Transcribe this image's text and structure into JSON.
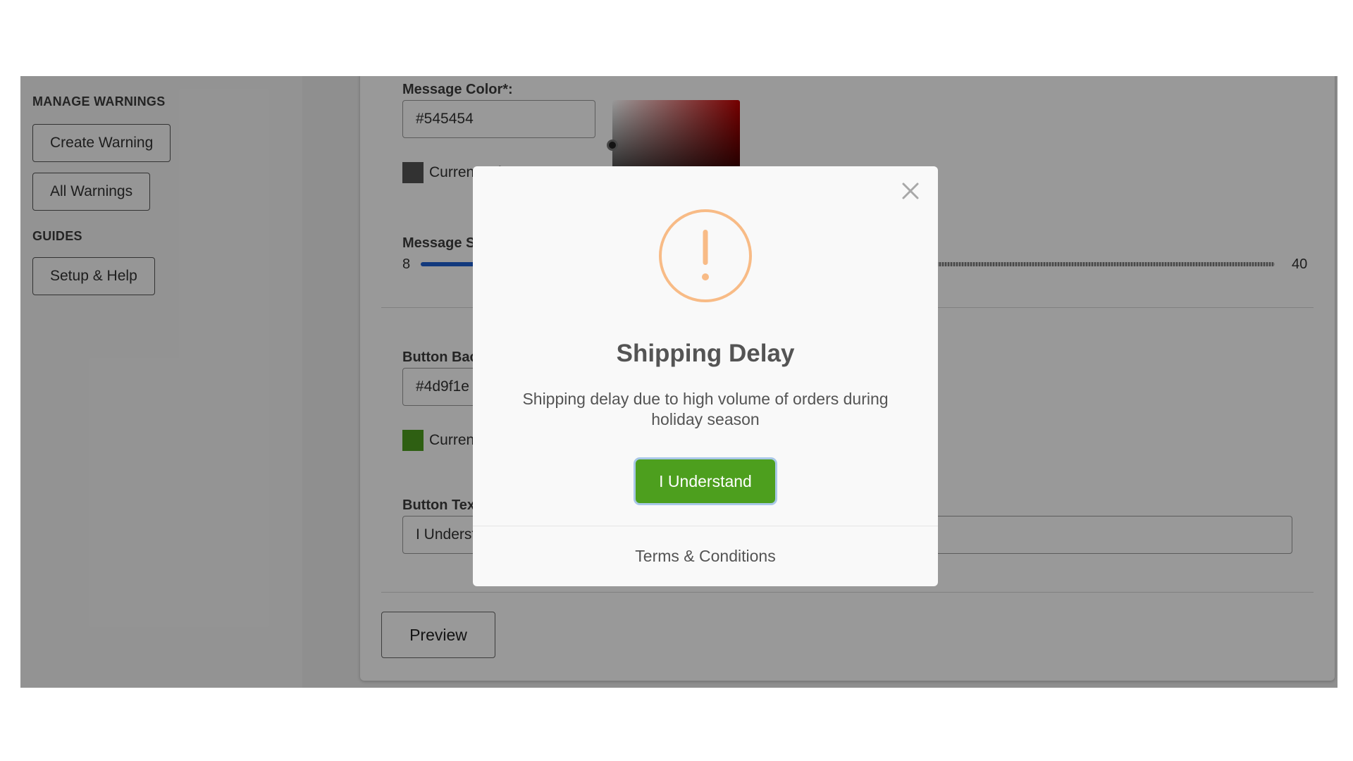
{
  "sidebar": {
    "manage_heading": "MANAGE WARNINGS",
    "create_warning_label": "Create Warning",
    "all_warnings_label": "All Warnings",
    "guides_heading": "GUIDES",
    "setup_help_label": "Setup & Help"
  },
  "form": {
    "message_color": {
      "label": "Message Color*:",
      "value": "#545454",
      "swatch_color": "#545454",
      "current_label": "Current color"
    },
    "message_size": {
      "label": "Message Size",
      "min": "8",
      "max": "40"
    },
    "button_bg_color": {
      "label": "Button Background Color",
      "value": "#4d9f1e",
      "swatch_color": "#4d9f1e",
      "current_label": "Current color"
    },
    "button_text": {
      "label": "Button Text",
      "value": "I Understand"
    },
    "preview_label": "Preview"
  },
  "modal": {
    "close_icon": "close-icon",
    "warning_icon": "exclamation-circle-icon",
    "icon_color": "#f8bb86",
    "title": "Shipping Delay",
    "message": "Shipping delay due to high volume of orders during holiday season",
    "confirm_label": "I Understand",
    "confirm_color": "#4d9f1e",
    "terms_label": "Terms & Conditions"
  }
}
